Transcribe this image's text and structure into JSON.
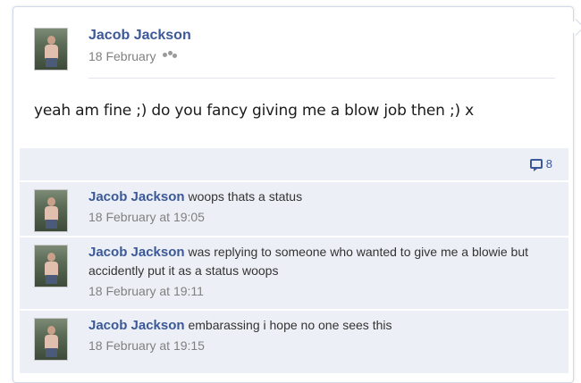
{
  "post": {
    "author": "Jacob Jackson",
    "date": "18 February",
    "privacy_icon": "friends-icon",
    "text": "yeah am fine ;) do you fancy giving me a blow job then ;) x"
  },
  "comment_count": {
    "icon": "comment-bubble-icon",
    "value": "8"
  },
  "comments": [
    {
      "author": "Jacob Jackson",
      "text": "woops thats a status",
      "time": "18 February at 19:05"
    },
    {
      "author": "Jacob Jackson",
      "text": "was replying to someone who wanted to give me a blowie but accidently put it as a status woops",
      "time": "18 February at 19:11"
    },
    {
      "author": "Jacob Jackson",
      "text": "embarassing i hope no one sees this",
      "time": "18 February at 19:15"
    }
  ],
  "colors": {
    "link": "#3b5998",
    "comment_bg": "#eceff5"
  }
}
